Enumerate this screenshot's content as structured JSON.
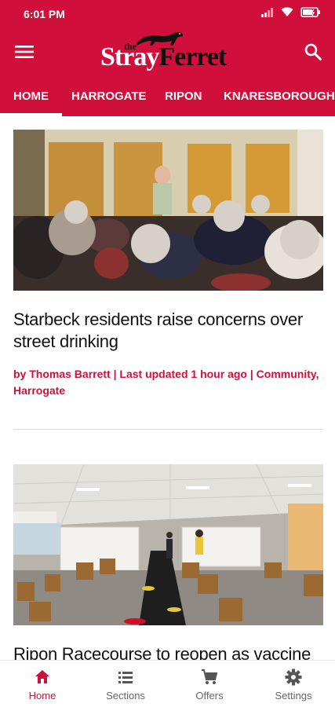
{
  "status_bar": {
    "time": "6:01 PM"
  },
  "brand": {
    "logo_the": "the",
    "logo_stray": "Stray",
    "logo_ferret": "Ferret",
    "accent_color": "#d0103a"
  },
  "header": {
    "menu_icon": "hamburger-menu-icon",
    "search_icon": "search-icon"
  },
  "tabs": [
    {
      "label": "HOME",
      "active": true
    },
    {
      "label": "HARROGATE",
      "active": false
    },
    {
      "label": "RIPON",
      "active": false
    },
    {
      "label": "KNARESBOROUGH",
      "active": false
    }
  ],
  "articles": [
    {
      "title": "Starbeck residents raise concerns over street drinking",
      "meta": "by Thomas Barrett | Last updated 1 hour ago | Community, Harrogate"
    },
    {
      "title": "Ripon Racecourse to reopen as vaccine"
    }
  ],
  "bottom_nav": [
    {
      "label": "Home",
      "icon": "home-icon",
      "active": true
    },
    {
      "label": "Sections",
      "icon": "list-icon",
      "active": false
    },
    {
      "label": "Offers",
      "icon": "cart-icon",
      "active": false
    },
    {
      "label": "Settings",
      "icon": "gear-icon",
      "active": false
    }
  ]
}
